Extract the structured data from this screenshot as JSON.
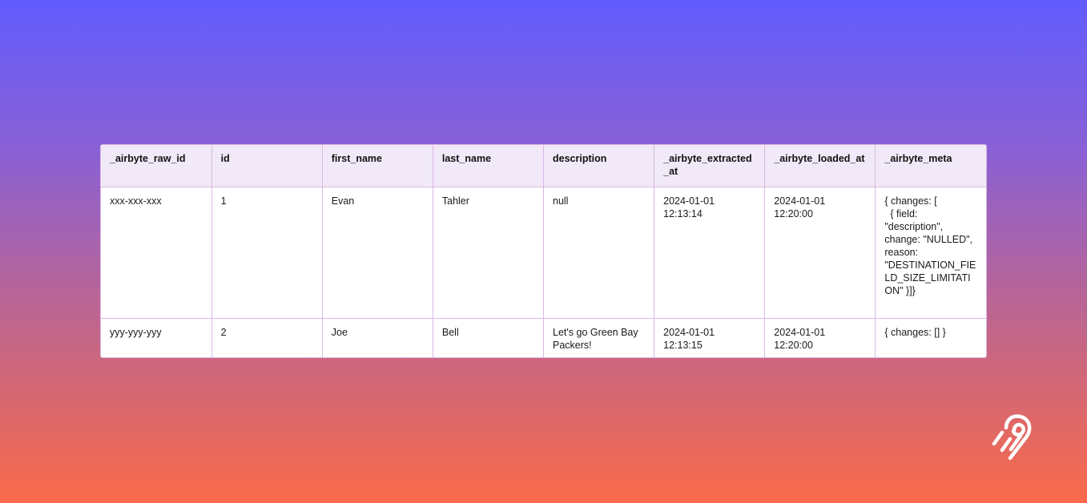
{
  "table": {
    "headers": [
      "_airbyte_raw_id",
      "id",
      "first_name",
      "last_name",
      "description",
      "_airbyte_extracted_at",
      "_airbyte_loaded_at",
      "_airbyte_meta"
    ],
    "rows": [
      [
        "xxx-xxx-xxx",
        "1",
        "Evan",
        "Tahler",
        "null",
        "2024-01-01 12:13:14",
        "2024-01-01 12:20:00",
        "{ changes: [\n  { field: \"description\", change: \"NULLED\", reason: \"DESTINATION_FIELD_SIZE_LIMITATION\" }]}"
      ],
      [
        "yyy-yyy-yyy",
        "2",
        "Joe",
        "Bell",
        "Let's go Green Bay Packers!",
        "2024-01-01 12:13:15",
        "2024-01-01 12:20:00",
        "{ changes: [] }"
      ]
    ]
  },
  "logo": {
    "icon": "airbyte-logo-icon",
    "color": "#ffffff"
  },
  "colors": {
    "gradient_top": "#615cfe",
    "gradient_bottom": "#fb6a4a",
    "header_bg": "#f1e9f7",
    "border": "#d9b8e4"
  }
}
